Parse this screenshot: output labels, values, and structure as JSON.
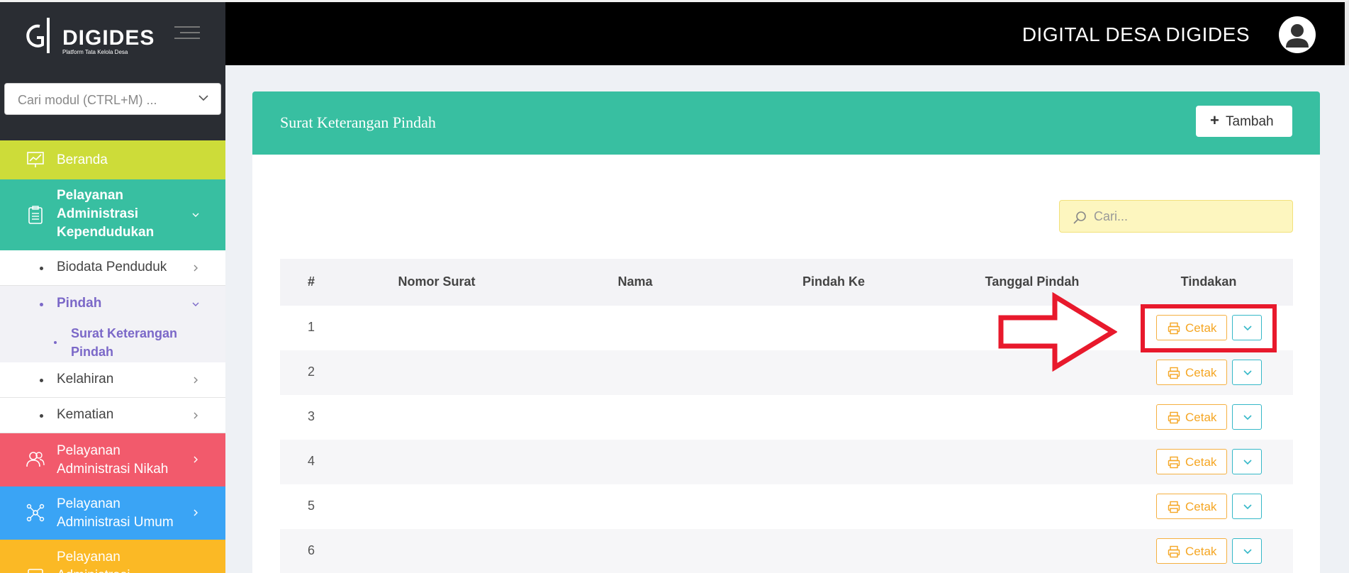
{
  "header": {
    "brand_name": "DIGIDES",
    "brand_tagline": "Platform Tata Kelola Desa",
    "title": "DIGITAL DESA DIGIDES",
    "avatar_icon": "user-avatar-icon"
  },
  "sidebar": {
    "search_placeholder": "Cari modul (CTRL+M) ...",
    "items": [
      {
        "label": "Beranda",
        "icon": "chart-board-icon",
        "color": "#cddc39"
      },
      {
        "label": "Pelayanan Administrasi Kependudukan",
        "icon": "clipboard-list-icon",
        "color": "#38bfa1"
      },
      {
        "label": "Biodata Penduduk"
      },
      {
        "label": "Pindah"
      },
      {
        "label": "Surat Keterangan Pindah"
      },
      {
        "label": "Kelahiran"
      },
      {
        "label": "Kematian"
      },
      {
        "label": "Pelayanan Administrasi Nikah",
        "icon": "users-icon",
        "color": "#f25a6c"
      },
      {
        "label": "Pelayanan Administrasi Umum",
        "icon": "network-icon",
        "color": "#3aa4f5"
      },
      {
        "label": "Pelayanan Administrasi",
        "icon": "document-icon",
        "color": "#fbb925"
      }
    ],
    "active_color": "#7b68c8"
  },
  "card": {
    "title": "Surat Keterangan Pindah",
    "add_button": "Tambah",
    "search_placeholder": "Cari...",
    "columns": [
      "#",
      "Nomor Surat",
      "Nama",
      "Pindah Ke",
      "Tanggal Pindah",
      "Tindakan"
    ],
    "rows": [
      {
        "no": "1",
        "nomor": "",
        "nama": "",
        "pindah_ke": "",
        "tanggal": ""
      },
      {
        "no": "2",
        "nomor": "",
        "nama": "",
        "pindah_ke": "",
        "tanggal": ""
      },
      {
        "no": "3",
        "nomor": "",
        "nama": "",
        "pindah_ke": "",
        "tanggal": ""
      },
      {
        "no": "4",
        "nomor": "",
        "nama": "",
        "pindah_ke": "",
        "tanggal": ""
      },
      {
        "no": "5",
        "nomor": "",
        "nama": "",
        "pindah_ke": "",
        "tanggal": ""
      },
      {
        "no": "6",
        "nomor": "",
        "nama": "",
        "pindah_ke": "",
        "tanggal": ""
      }
    ],
    "print_label": "Cetak",
    "accent": "#38bfa1"
  }
}
